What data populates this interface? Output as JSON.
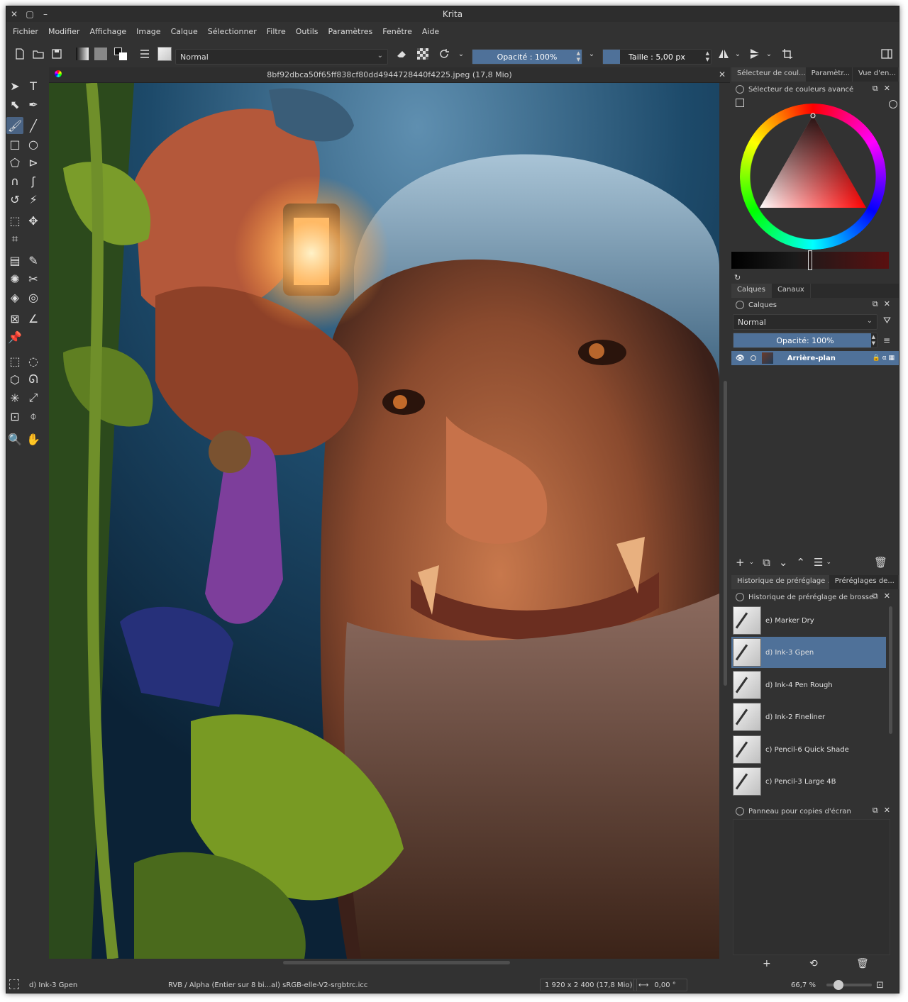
{
  "window": {
    "title": "Krita"
  },
  "menu": [
    "Fichier",
    "Modifier",
    "Affichage",
    "Image",
    "Calque",
    "Sélectionner",
    "Filtre",
    "Outils",
    "Paramètres",
    "Fenêtre",
    "Aide"
  ],
  "toolbar": {
    "blend_mode": "Normal",
    "opacity_label": "Opacité : 100%",
    "opacity_value": 1.0,
    "size_label": "Taille : 5,00 px",
    "size_value": 5.0
  },
  "document": {
    "tab_title": "8bf92dbca50f65ff838cf80dd4944728440f4225.jpeg (17,8 Mio)"
  },
  "dock": {
    "top_tabs": [
      "Sélecteur de coul...",
      "Paramètr...",
      "Vue d'en..."
    ],
    "color_panel_title": "Sélecteur de couleurs avancé",
    "layer_tabs": [
      "Calques",
      "Canaux"
    ],
    "layers_panel_title": "Calques",
    "layer_blend": "Normal",
    "layer_opacity_label": "Opacité:  100%",
    "layers": [
      {
        "name": "Arrière-plan"
      }
    ],
    "preset_tabs": [
      "Historique de préréglage ...",
      "Préréglages de..."
    ],
    "preset_panel_title": "Historique de préréglage de brosse",
    "presets": [
      {
        "name": "e) Marker Dry",
        "selected": false
      },
      {
        "name": "d) Ink-3 Gpen",
        "selected": true
      },
      {
        "name": "d) Ink-4 Pen Rough",
        "selected": false
      },
      {
        "name": "d) Ink-2 Fineliner",
        "selected": false
      },
      {
        "name": "c) Pencil-6 Quick Shade",
        "selected": false
      },
      {
        "name": "c) Pencil-3 Large 4B",
        "selected": false
      }
    ],
    "snapshot_panel_title": "Panneau pour copies d'écran"
  },
  "status": {
    "brush": "d) Ink-3 Gpen",
    "color_profile": "RVB / Alpha (Entier sur 8 bi...al) sRGB-elle-V2-srgbtrc.icc",
    "dimensions": "1 920 x 2 400 (17,8 Mio)",
    "rotation": "0,00 °",
    "zoom": "66,7 %",
    "zoom_value": 0.667
  },
  "colors": {
    "accent": "#4f7199",
    "panel": "#323232"
  },
  "icons": [
    "close-icon",
    "maximize-icon",
    "minimize-icon",
    "new-document-icon",
    "open-icon",
    "save-icon",
    "eraser-icon",
    "reload-icon",
    "mirror-icon",
    "wrap-icon",
    "layout-icon",
    "eye-icon",
    "filter-icon",
    "add-icon",
    "delete-icon"
  ]
}
